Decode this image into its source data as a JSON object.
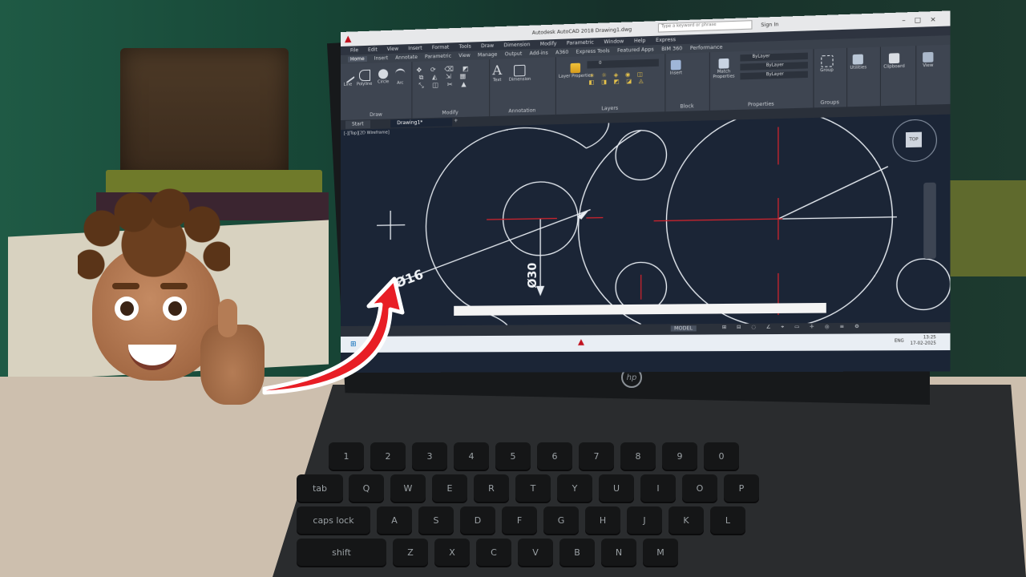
{
  "app": {
    "title": "Autodesk AutoCAD 2018   Drawing1.dwg",
    "search_placeholder": "Type a keyword or phrase",
    "sign_in": "Sign In"
  },
  "menus": [
    "File",
    "Edit",
    "View",
    "Insert",
    "Format",
    "Tools",
    "Draw",
    "Dimension",
    "Modify",
    "Parametric",
    "Window",
    "Help",
    "Express"
  ],
  "ribbon_tabs": [
    "Home",
    "Insert",
    "Annotate",
    "Parametric",
    "View",
    "Manage",
    "Output",
    "Add-ins",
    "A360",
    "Express Tools",
    "Featured Apps",
    "BIM 360",
    "Performance"
  ],
  "ribbon": {
    "draw": {
      "label": "Draw",
      "tools": [
        "Line",
        "Polyline",
        "Circle",
        "Arc"
      ]
    },
    "modify": {
      "label": "Modify"
    },
    "annotation": {
      "label": "Annotation",
      "tools": [
        "Text",
        "Dimension"
      ]
    },
    "layers": {
      "label": "Layers",
      "tools": [
        "Layer Properties"
      ]
    },
    "block": {
      "label": "Block",
      "tools": [
        "Insert"
      ]
    },
    "properties": {
      "label": "Properties",
      "tools": [
        "Match Properties"
      ],
      "bylayer": "ByLayer"
    },
    "groups": {
      "label": "Groups",
      "tools": [
        "Group"
      ]
    },
    "utilities": "Utilities",
    "clipboard": "Clipboard",
    "view": "View",
    "layer_current": "0"
  },
  "doc_tabs": [
    "Start",
    "Drawing1*"
  ],
  "viewport_label": "[-][Top][2D Wireframe]",
  "navcube_label": "TOP",
  "dimensions": {
    "d16": "Ø16",
    "d30": "Ø30"
  },
  "status": {
    "model": "MODEL"
  },
  "taskbar": {
    "time": "13:25",
    "date": "17-02-2025",
    "lang": "ENG"
  },
  "laptop_brand": "hp",
  "keyboard": {
    "row1": [
      "1",
      "2",
      "3",
      "4",
      "5",
      "6",
      "7",
      "8",
      "9",
      "0"
    ],
    "row2": [
      "Q",
      "W",
      "E",
      "R",
      "T",
      "Y",
      "U",
      "I",
      "O",
      "P"
    ],
    "row3": [
      "A",
      "S",
      "D",
      "F",
      "G",
      "H",
      "J",
      "K",
      "L"
    ],
    "row4": [
      "Z",
      "X",
      "C",
      "V",
      "B",
      "N",
      "M"
    ],
    "caps": "caps lock",
    "shift": "shift",
    "tab": "tab"
  },
  "colors": {
    "accent_red": "#e3212b",
    "canvas": "#1b2536",
    "ribbon": "#3e4551"
  }
}
